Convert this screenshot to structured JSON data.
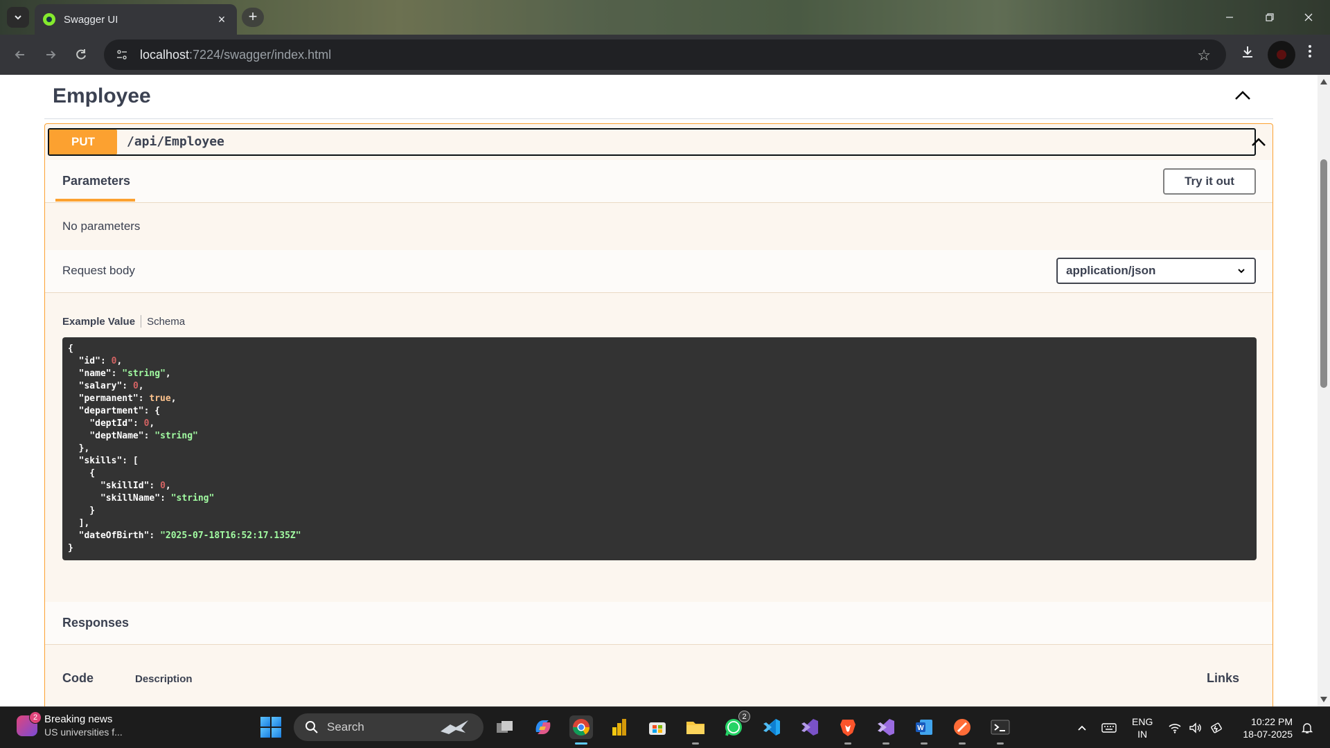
{
  "browser": {
    "tab_title": "Swagger UI",
    "url_host": "localhost",
    "url_rest": ":7224/swagger/index.html"
  },
  "swagger": {
    "section_title": "Employee",
    "method": "PUT",
    "path": "/api/Employee",
    "parameters_tab": "Parameters",
    "try_button": "Try it out",
    "no_parameters": "No parameters",
    "request_body_label": "Request body",
    "content_type": "application/json",
    "example_tab": "Example Value",
    "schema_tab": "Schema",
    "example_lines": [
      [
        [
          "p",
          "{"
        ]
      ],
      [
        [
          "p",
          "  "
        ],
        [
          "k",
          "\"id\""
        ],
        [
          "p",
          ": "
        ],
        [
          "n",
          "0"
        ],
        [
          "p",
          ","
        ]
      ],
      [
        [
          "p",
          "  "
        ],
        [
          "k",
          "\"name\""
        ],
        [
          "p",
          ": "
        ],
        [
          "s",
          "\"string\""
        ],
        [
          "p",
          ","
        ]
      ],
      [
        [
          "p",
          "  "
        ],
        [
          "k",
          "\"salary\""
        ],
        [
          "p",
          ": "
        ],
        [
          "n",
          "0"
        ],
        [
          "p",
          ","
        ]
      ],
      [
        [
          "p",
          "  "
        ],
        [
          "k",
          "\"permanent\""
        ],
        [
          "p",
          ": "
        ],
        [
          "b",
          "true"
        ],
        [
          "p",
          ","
        ]
      ],
      [
        [
          "p",
          "  "
        ],
        [
          "k",
          "\"department\""
        ],
        [
          "p",
          ": {"
        ]
      ],
      [
        [
          "p",
          "    "
        ],
        [
          "k",
          "\"deptId\""
        ],
        [
          "p",
          ": "
        ],
        [
          "n",
          "0"
        ],
        [
          "p",
          ","
        ]
      ],
      [
        [
          "p",
          "    "
        ],
        [
          "k",
          "\"deptName\""
        ],
        [
          "p",
          ": "
        ],
        [
          "s",
          "\"string\""
        ]
      ],
      [
        [
          "p",
          "  },"
        ]
      ],
      [
        [
          "p",
          "  "
        ],
        [
          "k",
          "\"skills\""
        ],
        [
          "p",
          ": ["
        ]
      ],
      [
        [
          "p",
          "    {"
        ]
      ],
      [
        [
          "p",
          "      "
        ],
        [
          "k",
          "\"skillId\""
        ],
        [
          "p",
          ": "
        ],
        [
          "n",
          "0"
        ],
        [
          "p",
          ","
        ]
      ],
      [
        [
          "p",
          "      "
        ],
        [
          "k",
          "\"skillName\""
        ],
        [
          "p",
          ": "
        ],
        [
          "s",
          "\"string\""
        ]
      ],
      [
        [
          "p",
          "    }"
        ]
      ],
      [
        [
          "p",
          "  ],"
        ]
      ],
      [
        [
          "p",
          "  "
        ],
        [
          "k",
          "\"dateOfBirth\""
        ],
        [
          "p",
          ": "
        ],
        [
          "s",
          "\"2025-07-18T16:52:17.135Z\""
        ]
      ],
      [
        [
          "p",
          "}"
        ]
      ]
    ],
    "responses_title": "Responses",
    "col_code": "Code",
    "col_description": "Description",
    "col_links": "Links"
  },
  "taskbar": {
    "news_badge": "2",
    "news_title": "Breaking news",
    "news_sub": "US universities f...",
    "search_label": "Search",
    "whatsapp_badge": "2",
    "lang_top": "ENG",
    "lang_bottom": "IN",
    "time": "10:22 PM",
    "date": "18-07-2025",
    "apps": [
      "task-view",
      "copilot",
      "chrome",
      "power-bi",
      "microsoft-store",
      "file-explorer",
      "whatsapp",
      "vscode",
      "visual-studio",
      "brave",
      "visual-studio-preview",
      "word",
      "postman",
      "terminal"
    ]
  },
  "colors": {
    "put_method": "#fca130",
    "opblock_bg": "#fcf6ef",
    "code_bg": "#333333",
    "taskbar_bg": "#1c1c1c"
  }
}
